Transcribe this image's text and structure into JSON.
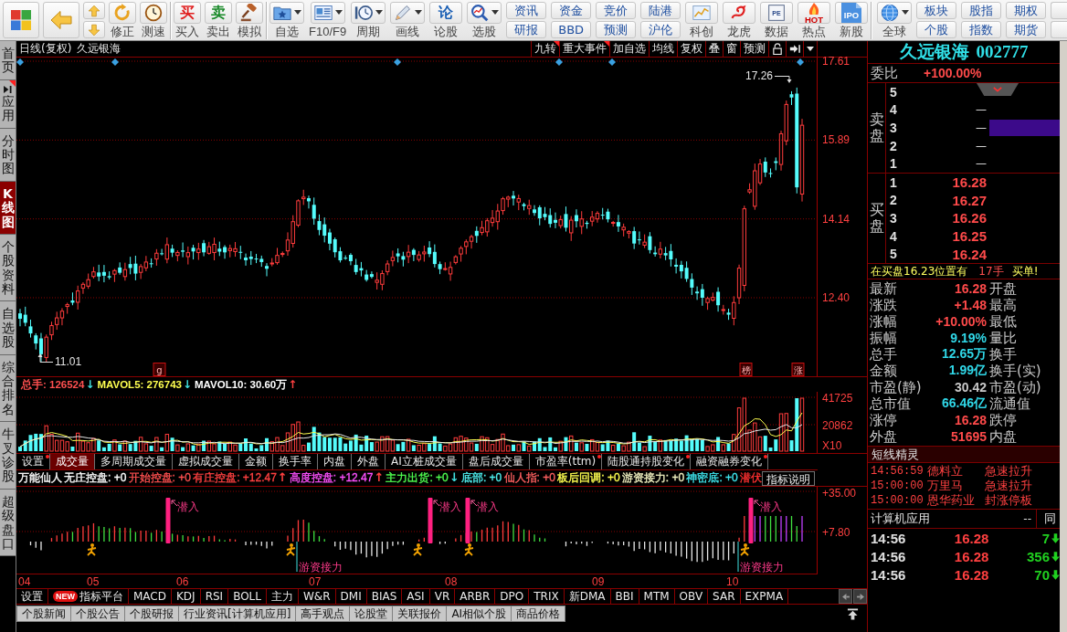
{
  "toolbar": {
    "groups": [
      {
        "buttons": [
          {
            "kind": "tile"
          },
          {
            "kind": "tile"
          },
          {
            "kind": "stack"
          },
          {
            "kind": "icon",
            "label": "修正"
          },
          {
            "kind": "icon",
            "label": "测速"
          }
        ]
      },
      {
        "buttons": [
          {
            "kind": "glyph",
            "glyph": "买",
            "label": "买入",
            "color": "#e02020"
          },
          {
            "kind": "glyph",
            "glyph": "卖",
            "label": "卖出",
            "color": "#1a8a2a"
          },
          {
            "kind": "icon",
            "label": "模拟"
          }
        ]
      },
      {
        "buttons": [
          {
            "kind": "split",
            "label": "自选"
          },
          {
            "kind": "split",
            "label": "F10/F9"
          },
          {
            "kind": "split",
            "label": "周期"
          },
          {
            "kind": "split",
            "label": "画线"
          },
          {
            "kind": "glyph",
            "glyph": "论",
            "label": "论股",
            "color": "#1a5fb4"
          },
          {
            "kind": "split",
            "label": "选股"
          },
          {
            "kind": "pair",
            "labels": [
              "资讯",
              "研报"
            ]
          },
          {
            "kind": "pair",
            "labels": [
              "资金",
              "BBD"
            ]
          },
          {
            "kind": "pair",
            "labels": [
              "竞价",
              "预测"
            ]
          },
          {
            "kind": "pair",
            "labels": [
              "陆港",
              "沪伦"
            ]
          },
          {
            "kind": "icon",
            "label": "科创"
          },
          {
            "kind": "icon",
            "label": "龙虎"
          },
          {
            "kind": "badge",
            "glyph": "PE",
            "label": "数据"
          },
          {
            "kind": "badge",
            "glyph": "HOT",
            "label": "热点"
          },
          {
            "kind": "badge",
            "glyph": "IPO",
            "label": "新股"
          }
        ]
      },
      {
        "buttons": [
          {
            "kind": "split",
            "label": "全球"
          },
          {
            "kind": "pair",
            "labels": [
              "板块",
              "个股"
            ]
          },
          {
            "kind": "pair",
            "labels": [
              "股指",
              "指数"
            ]
          },
          {
            "kind": "pair",
            "labels": [
              "期权",
              "期货"
            ]
          },
          {
            "kind": "stub"
          }
        ]
      }
    ]
  },
  "sidebar": {
    "tabs": [
      {
        "label": "首页",
        "selected": false,
        "flag": false
      },
      {
        "label": "应用",
        "selected": false,
        "flag": true
      },
      {
        "label": "分时图",
        "selected": false,
        "flag": false
      },
      {
        "label": "K线图",
        "selected": true,
        "flag": false
      },
      {
        "label": "个股资料",
        "selected": false,
        "flag": false
      },
      {
        "label": "自选股",
        "selected": false,
        "flag": false
      },
      {
        "label": "综合排名",
        "selected": false,
        "flag": false
      },
      {
        "label": "牛叉诊股",
        "selected": false,
        "flag": false
      },
      {
        "label": "超级盘口",
        "selected": false,
        "flag": false
      }
    ]
  },
  "price_chart": {
    "title": "日线(复权)",
    "stock": "久远银海",
    "buttons": [
      {
        "label": "九转",
        "flag": true
      },
      {
        "label": "重大事件",
        "flag": true
      },
      {
        "label": "加自选",
        "flag": false
      },
      {
        "label": "均线",
        "flag": false
      },
      {
        "label": "复权",
        "flag": false
      },
      {
        "label": "叠",
        "flag": false
      },
      {
        "label": "窗",
        "flag": false
      },
      {
        "label": "预测",
        "flag": false
      }
    ],
    "axis": [
      "17.61",
      "15.89",
      "14.14",
      "12.40"
    ],
    "high": "17.26",
    "low": "11.01",
    "tags": [
      "g",
      "榜",
      "涨"
    ]
  },
  "volume": {
    "legend": [
      {
        "label": "总手:",
        "value": "126524",
        "color": "#ff5050",
        "arrow": {
          "text": "↓",
          "color": "#40e0e0"
        }
      },
      {
        "label": "MAVOL5:",
        "value": "276743",
        "color": "#ffff50",
        "arrow": {
          "text": "↓",
          "color": "#40e0e0"
        }
      },
      {
        "label": "MAVOL10:",
        "value": "30.60万",
        "color": "#ffffff",
        "arrow": {
          "text": "↑",
          "color": "#ff4040"
        }
      }
    ],
    "axis": [
      "41725",
      "20862",
      "X10"
    ],
    "settings": {
      "label": "设置",
      "flag": true
    },
    "tabs": [
      {
        "label": "成交量",
        "selected": true,
        "flag": false
      },
      {
        "label": "多周期成交量",
        "selected": false,
        "flag": false
      },
      {
        "label": "虚拟成交量",
        "selected": false,
        "flag": false
      },
      {
        "label": "金额",
        "selected": false,
        "flag": false
      },
      {
        "label": "换手率",
        "selected": false,
        "flag": false
      },
      {
        "label": "内盘",
        "selected": false,
        "flag": false
      },
      {
        "label": "外盘",
        "selected": false,
        "flag": false
      },
      {
        "label": "AI立桩成交量",
        "selected": false,
        "flag": false
      },
      {
        "label": "盘后成交量",
        "selected": false,
        "flag": false
      },
      {
        "label": "市盈率(ttm)",
        "selected": false,
        "flag": true
      },
      {
        "label": "陆股通持股变化",
        "selected": false,
        "flag": true
      },
      {
        "label": "融资融券变化",
        "selected": false,
        "flag": true
      }
    ]
  },
  "indicator": {
    "name": "万能仙人",
    "legend": [
      {
        "label": "无庄控盘:",
        "value": "+0",
        "color": "#ffffff"
      },
      {
        "label": "开始控盘:",
        "value": "+0",
        "color": "#ff5050"
      },
      {
        "label": "有庄控盘:",
        "value": "+12.47",
        "color": "#ff4040",
        "arrow": {
          "text": "↑",
          "color": "#ff4040"
        }
      },
      {
        "label": "高度控盘:",
        "value": "+12.47",
        "color": "#ff50ff",
        "arrow": {
          "text": "↑",
          "color": "#ff4040"
        }
      },
      {
        "label": "主力出货:",
        "value": "+0",
        "color": "#50ff50",
        "arrow": {
          "text": "↓",
          "color": "#40e0e0"
        }
      },
      {
        "label": "底部:",
        "value": "+0",
        "color": "#50f0f0"
      },
      {
        "label": "仙人指:",
        "value": "+0",
        "color": "#ff6060"
      },
      {
        "label": "板后回调:",
        "value": "+0",
        "color": "#ffff50"
      },
      {
        "label": "游资接力:",
        "value": "+0",
        "color": "#f0f0c0"
      },
      {
        "label": "神密底:",
        "value": "+0",
        "color": "#40e8f0"
      },
      {
        "label": "潜伏",
        "color": "#ff3030"
      }
    ],
    "help": "指标说明",
    "axis": [
      "+35.00",
      "+7.80"
    ],
    "signals": [
      "潜入",
      "潜入",
      "潜入",
      "潜入"
    ],
    "relay_labels": [
      "游资接力",
      "游资接力"
    ]
  },
  "dates": [
    "04",
    "05",
    "06",
    "07",
    "08",
    "09",
    "10"
  ],
  "indicator_tabs": {
    "settings": "设置",
    "platform": {
      "badge": "NEW",
      "label": "指标平台"
    },
    "tabs": [
      {
        "label": "MACD",
        "selected": false
      },
      {
        "label": "KDJ",
        "selected": false
      },
      {
        "label": "RSI",
        "selected": false
      },
      {
        "label": "BOLL",
        "selected": false
      },
      {
        "label": "主力",
        "selected": false
      },
      {
        "label": "W&R",
        "selected": false
      },
      {
        "label": "DMI",
        "selected": false
      },
      {
        "label": "BIAS",
        "selected": false
      },
      {
        "label": "ASI",
        "selected": false
      },
      {
        "label": "VR",
        "selected": false
      },
      {
        "label": "ARBR",
        "selected": false
      },
      {
        "label": "DPO",
        "selected": false
      },
      {
        "label": "TRIX",
        "selected": false
      },
      {
        "label": "新DMA",
        "selected": false
      },
      {
        "label": "BBI",
        "selected": false
      },
      {
        "label": "MTM",
        "selected": false
      },
      {
        "label": "OBV",
        "selected": false
      },
      {
        "label": "SAR",
        "selected": false
      },
      {
        "label": "EXPMA",
        "selected": false
      }
    ]
  },
  "news_tabs": [
    {
      "label": "个股新闻",
      "selected": false
    },
    {
      "label": "个股公告",
      "selected": false
    },
    {
      "label": "个股研报",
      "selected": false
    },
    {
      "label": "行业资讯[计算机应用]",
      "selected": false
    },
    {
      "label": "高手观点",
      "selected": false
    },
    {
      "label": "论股堂",
      "selected": false
    },
    {
      "label": "关联报价",
      "selected": false
    },
    {
      "label": "AI相似个股",
      "selected": false
    },
    {
      "label": "商品价格",
      "selected": false
    }
  ],
  "quote_panel": {
    "name": "久远银海",
    "code": "002777",
    "ratio_label": "委比",
    "ratio": "+100.00%",
    "sell_label": "卖盘",
    "sell": [
      {
        "rank": "5",
        "highlight": false
      },
      {
        "rank": "4",
        "price": "—",
        "highlight": false
      },
      {
        "rank": "3",
        "price": "—",
        "highlight": true
      },
      {
        "rank": "2",
        "price": "—",
        "highlight": false
      },
      {
        "rank": "1",
        "price": "—",
        "highlight": false
      }
    ],
    "buy_label": "买盘",
    "buy": [
      {
        "rank": "1",
        "price": "16.28"
      },
      {
        "rank": "2",
        "price": "16.27"
      },
      {
        "rank": "3",
        "price": "16.26"
      },
      {
        "rank": "4",
        "price": "16.25"
      },
      {
        "rank": "5",
        "price": "16.24"
      }
    ],
    "notice": {
      "text": "在买盘16.23位置有",
      "lots": "17手",
      "tail": "买单!"
    },
    "stats": [
      {
        "label": "最新",
        "value": "16.28",
        "color": "#ff4a4a",
        "label2": "开盘"
      },
      {
        "label": "涨跌",
        "value": "+1.48",
        "color": "#ff4a4a",
        "label2": "最高"
      },
      {
        "label": "涨幅",
        "value": "+10.00%",
        "color": "#ff4a4a",
        "label2": "最低"
      },
      {
        "label": "振幅",
        "value": "9.19%",
        "color": "#30d8e8",
        "label2": "量比"
      },
      {
        "label": "总手",
        "value": "12.65万",
        "color": "#30d8e8",
        "label2": "换手"
      },
      {
        "label": "金额",
        "value": "1.99亿",
        "color": "#30d8e8",
        "label2": "换手(实)"
      },
      {
        "label": "市盈(静)",
        "value": "30.42",
        "color": "#c8c8c8",
        "label2": "市盈(动)"
      },
      {
        "label": "总市值",
        "value": "66.46亿",
        "color": "#30d8e8",
        "label2": "流通值"
      },
      {
        "label": "涨停",
        "value": "16.28",
        "color": "#ff4a4a",
        "label2": "跌停"
      },
      {
        "label": "外盘",
        "value": "51695",
        "color": "#ff4a4a",
        "label2": "内盘"
      }
    ]
  },
  "sprite": {
    "title": "短线精灵",
    "rows": [
      {
        "time": "14:56:59",
        "stock": "德料立",
        "event": "急速拉升"
      },
      {
        "time": "15:00:00",
        "stock": "万里马",
        "event": "急速拉升"
      },
      {
        "time": "15:00:00",
        "stock": "恩华药业",
        "event": "封涨停板"
      }
    ]
  },
  "ticks": {
    "sector": "计算机应用",
    "change": "--",
    "tab": "同",
    "rows": [
      {
        "time": "14:56",
        "price": "16.28",
        "volume": "7",
        "falling": true
      },
      {
        "time": "14:56",
        "price": "16.28",
        "volume": "356",
        "falling": true
      },
      {
        "time": "14:56",
        "price": "16.28",
        "volume": "70",
        "falling": true
      }
    ]
  }
}
